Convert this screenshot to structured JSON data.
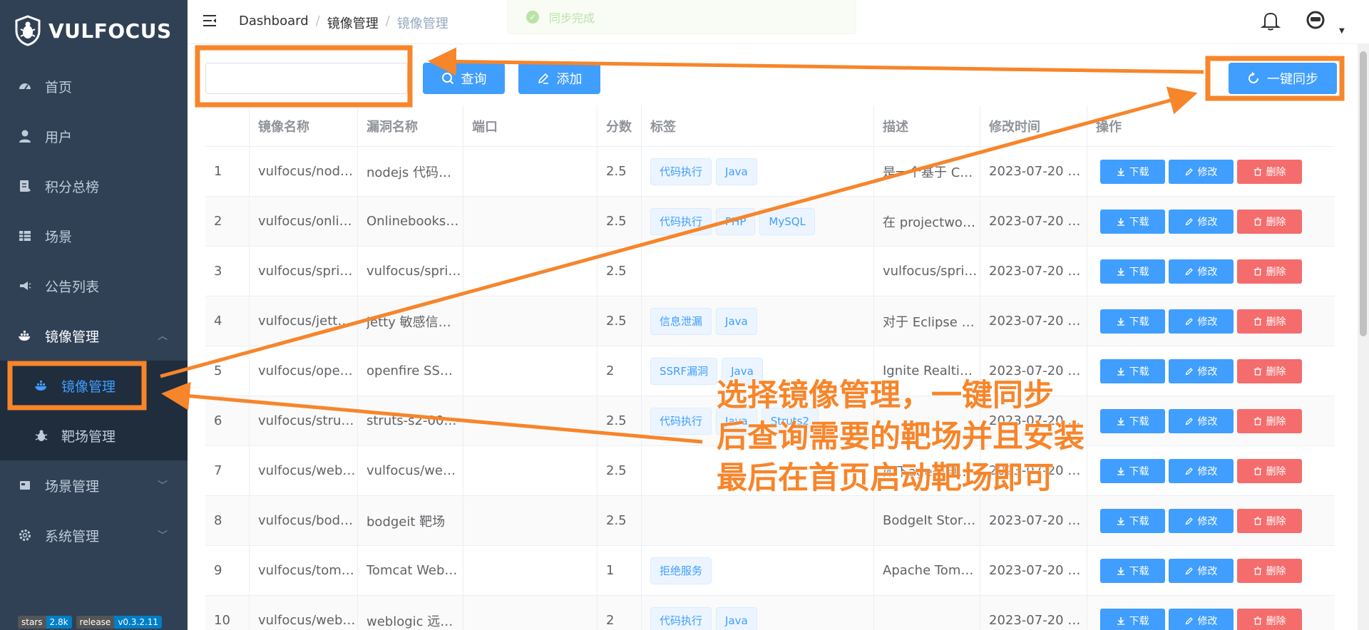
{
  "app": {
    "logo_text": "VULFOCUS"
  },
  "sidebar": {
    "items": [
      {
        "label": "首页",
        "icon": "dashboard-icon"
      },
      {
        "label": "用户",
        "icon": "user-icon"
      },
      {
        "label": "积分总榜",
        "icon": "ranking-icon"
      },
      {
        "label": "场景",
        "icon": "grid-icon"
      },
      {
        "label": "公告列表",
        "icon": "megaphone-icon"
      },
      {
        "label": "镜像管理",
        "icon": "docker-icon",
        "open": true
      },
      {
        "label": "镜像管理",
        "icon": "docker-icon",
        "sub": true,
        "active": true
      },
      {
        "label": "靶场管理",
        "icon": "bug-icon",
        "sub": true
      },
      {
        "label": "场景管理",
        "icon": "scene-icon"
      },
      {
        "label": "系统管理",
        "icon": "gear-icon"
      }
    ],
    "badges": [
      {
        "label": "stars",
        "value": "2.8k"
      },
      {
        "label": "release",
        "value": "v0.3.2.11"
      }
    ]
  },
  "header": {
    "breadcrumb": [
      "Dashboard",
      "镜像管理",
      "镜像管理"
    ],
    "toast": "同步完成"
  },
  "toolbar": {
    "search_value": "",
    "query_label": "查询",
    "add_label": "添加",
    "sync_label": "一键同步"
  },
  "table": {
    "headers": [
      "",
      "镜像名称",
      "漏洞名称",
      "端口",
      "分数",
      "标签",
      "描述",
      "修改时间",
      "操作"
    ],
    "actions": {
      "download": "下载",
      "edit": "修改",
      "delete": "删除"
    },
    "rows": [
      {
        "id": "1",
        "image": "vulfocus/nod…",
        "vuln": "nodejs 代码…",
        "port": "",
        "score": "2.5",
        "tags": [
          "代码执行",
          "Java"
        ],
        "desc": "是一个基于 C…",
        "time": "2023-07-20 …"
      },
      {
        "id": "2",
        "image": "vulfocus/onlin…",
        "vuln": "Onlinebookst…",
        "port": "",
        "score": "2.5",
        "tags": [
          "代码执行",
          "PHP",
          "MySQL"
        ],
        "desc": "在 projectwor…",
        "time": "2023-07-20 …"
      },
      {
        "id": "3",
        "image": "vulfocus/spri…",
        "vuln": "vulfocus/spri…",
        "port": "",
        "score": "2.5",
        "tags": [],
        "desc": "vulfocus/spri…",
        "time": "2023-07-20 …"
      },
      {
        "id": "4",
        "image": "vulfocus/jetty…",
        "vuln": "jetty 敏感信…",
        "port": "",
        "score": "2.5",
        "tags": [
          "信息泄漏",
          "Java"
        ],
        "desc": "对于 Eclipse …",
        "time": "2023-07-20 …"
      },
      {
        "id": "5",
        "image": "vulfocus/ope…",
        "vuln": "openfire SS…",
        "port": "",
        "score": "2",
        "tags": [
          "SSRF漏洞",
          "Java"
        ],
        "desc": "Ignite Realti…",
        "time": "2023-07-20 …"
      },
      {
        "id": "6",
        "image": "vulfocus/strut…",
        "vuln": "struts-s2-007…",
        "port": "",
        "score": "2.5",
        "tags": [
          "代码执行",
          "Java",
          "Struts2"
        ],
        "desc": "",
        "time": "2023-07-20 …"
      },
      {
        "id": "7",
        "image": "vulfocus/webl…",
        "vuln": "vulfocus/web…",
        "port": "",
        "score": "2.5",
        "tags": [],
        "desc": "如下age来自…",
        "time": "2023-07-20 …"
      },
      {
        "id": "8",
        "image": "vulfocus/bod…",
        "vuln": "bodgeit 靶场",
        "port": "",
        "score": "2.5",
        "tags": [],
        "desc": "BodgeIt Stor…",
        "time": "2023-07-20 …"
      },
      {
        "id": "9",
        "image": "vulfocus/tom…",
        "vuln": "Tomcat Web…",
        "port": "",
        "score": "1",
        "tags": [
          "拒绝服务"
        ],
        "desc": "Apache Tom…",
        "time": "2023-07-20 …"
      },
      {
        "id": "10",
        "image": "vulfocus/webl…",
        "vuln": "weblogic 远…",
        "port": "",
        "score": "2",
        "tags": [
          "代码执行",
          "Java"
        ],
        "desc": "",
        "time": "2023-07-20 …"
      }
    ]
  },
  "annotation": {
    "lines": [
      "选择镜像管理，一键同步",
      "后查询需要的靶场并且安装",
      "最后在首页启动靶场即可"
    ],
    "color": "#f7852a"
  }
}
